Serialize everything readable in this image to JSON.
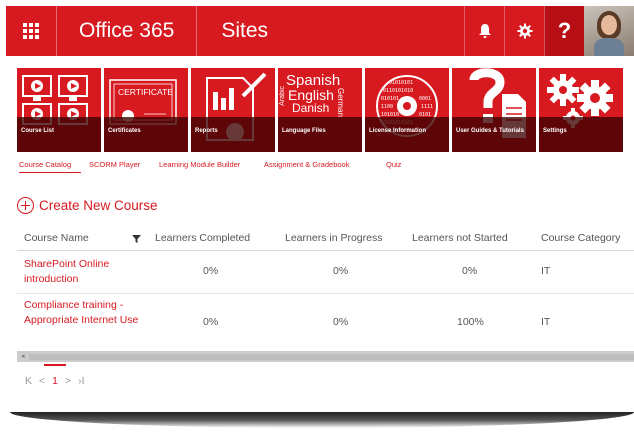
{
  "topbar": {
    "app_name": "Office 365",
    "site_name": "Sites",
    "help_label": "?",
    "color": "#d71920"
  },
  "tiles": [
    {
      "label": "Course List",
      "icon": "monitor-grid-icon"
    },
    {
      "label": "Certificates",
      "icon": "certificate-icon",
      "art_text": "CERTIFICATE"
    },
    {
      "label": "Reports",
      "icon": "report-chart-icon"
    },
    {
      "label": "Language Files",
      "icon": "language-icon",
      "art_text": [
        "Spanish",
        "English",
        "Danish",
        "German",
        "Arabic"
      ]
    },
    {
      "label": "License Information",
      "icon": "binary-disc-icon"
    },
    {
      "label": "User Guides & Tutorials",
      "icon": "question-document-icon"
    },
    {
      "label": "Settings",
      "icon": "gears-icon"
    }
  ],
  "subnav": [
    "Course Catalog",
    "SCORM Player",
    "Learning Module Builder",
    "Assignment & Gradebook",
    "Quiz"
  ],
  "create_label": "Create New Course",
  "table": {
    "columns": [
      "Course Name",
      "Learners Completed",
      "Learners in Progress",
      "Learners not Started",
      "Course Category"
    ],
    "rows": [
      {
        "name": "SharePoint Online introduction",
        "completed": "0%",
        "in_progress": "0%",
        "not_started": "0%",
        "category": "IT"
      },
      {
        "name": "Compliance training - Appropriate Internet Use",
        "completed": "0%",
        "in_progress": "0%",
        "not_started": "100%",
        "category": "IT"
      }
    ]
  },
  "pager": {
    "first": "K",
    "prev": "<",
    "current": "1",
    "next": ">",
    "last": "›I"
  }
}
